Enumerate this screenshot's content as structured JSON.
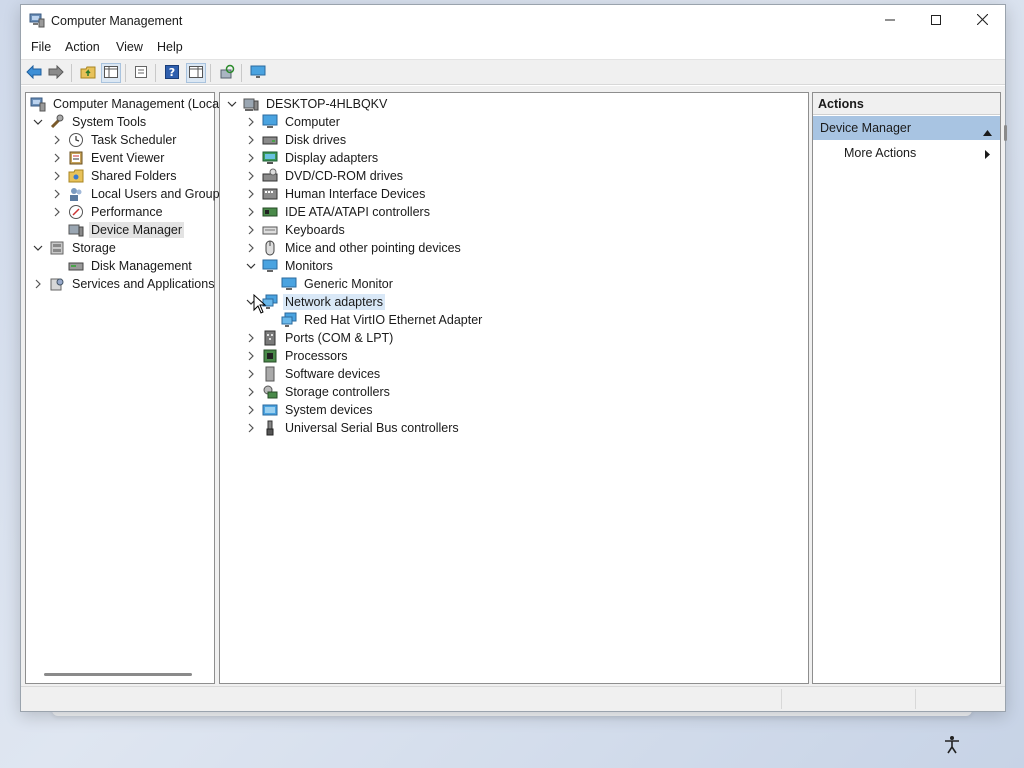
{
  "window": {
    "title": "Computer Management"
  },
  "menu": [
    "File",
    "Action",
    "View",
    "Help"
  ],
  "toolbar": {
    "buttons": [
      "back-icon",
      "forward-icon",
      "up-folder-icon",
      "show-hide-tree-icon",
      "properties-icon",
      "help-icon",
      "show-hide-action-pane-icon",
      "scan-hardware-icon",
      "monitor-icon"
    ]
  },
  "left_tree": {
    "root": "Computer Management (Local",
    "items": [
      {
        "label": "System Tools",
        "level": 1,
        "expander": "expanded",
        "icon": "tools-icon"
      },
      {
        "label": "Task Scheduler",
        "level": 2,
        "expander": "collapsed",
        "icon": "clock-icon"
      },
      {
        "label": "Event Viewer",
        "level": 2,
        "expander": "collapsed",
        "icon": "event-viewer-icon"
      },
      {
        "label": "Shared Folders",
        "level": 2,
        "expander": "collapsed",
        "icon": "shared-folder-icon"
      },
      {
        "label": "Local Users and Groups",
        "level": 2,
        "expander": "collapsed",
        "icon": "users-icon"
      },
      {
        "label": "Performance",
        "level": 2,
        "expander": "collapsed",
        "icon": "performance-icon"
      },
      {
        "label": "Device Manager",
        "level": 2,
        "expander": "none",
        "icon": "device-manager-icon",
        "selected": true
      },
      {
        "label": "Storage",
        "level": 1,
        "expander": "expanded",
        "icon": "storage-icon"
      },
      {
        "label": "Disk Management",
        "level": 2,
        "expander": "none",
        "icon": "disk-management-icon"
      },
      {
        "label": "Services and Applications",
        "level": 1,
        "expander": "collapsed",
        "icon": "services-icon"
      }
    ]
  },
  "device_tree": {
    "root": "DESKTOP-4HLBQKV",
    "items": [
      {
        "label": "Computer",
        "level": 1,
        "expander": "collapsed",
        "icon": "computer-icon"
      },
      {
        "label": "Disk drives",
        "level": 1,
        "expander": "collapsed",
        "icon": "disk-drive-icon"
      },
      {
        "label": "Display adapters",
        "level": 1,
        "expander": "collapsed",
        "icon": "display-adapter-icon"
      },
      {
        "label": "DVD/CD-ROM drives",
        "level": 1,
        "expander": "collapsed",
        "icon": "dvd-drive-icon"
      },
      {
        "label": "Human Interface Devices",
        "level": 1,
        "expander": "collapsed",
        "icon": "hid-icon"
      },
      {
        "label": "IDE ATA/ATAPI controllers",
        "level": 1,
        "expander": "collapsed",
        "icon": "ide-controller-icon"
      },
      {
        "label": "Keyboards",
        "level": 1,
        "expander": "collapsed",
        "icon": "keyboard-icon"
      },
      {
        "label": "Mice and other pointing devices",
        "level": 1,
        "expander": "collapsed",
        "icon": "mouse-icon"
      },
      {
        "label": "Monitors",
        "level": 1,
        "expander": "expanded",
        "icon": "monitor-icon"
      },
      {
        "label": "Generic Monitor",
        "level": 2,
        "expander": "none",
        "icon": "monitor-icon"
      },
      {
        "label": "Network adapters",
        "level": 1,
        "expander": "expanded",
        "icon": "network-adapter-icon",
        "selected": true
      },
      {
        "label": "Red Hat VirtIO Ethernet Adapter",
        "level": 2,
        "expander": "none",
        "icon": "network-adapter-icon"
      },
      {
        "label": "Ports (COM & LPT)",
        "level": 1,
        "expander": "collapsed",
        "icon": "port-icon"
      },
      {
        "label": "Processors",
        "level": 1,
        "expander": "collapsed",
        "icon": "processor-icon"
      },
      {
        "label": "Software devices",
        "level": 1,
        "expander": "collapsed",
        "icon": "software-device-icon"
      },
      {
        "label": "Storage controllers",
        "level": 1,
        "expander": "collapsed",
        "icon": "storage-controller-icon"
      },
      {
        "label": "System devices",
        "level": 1,
        "expander": "collapsed",
        "icon": "system-device-icon"
      },
      {
        "label": "Universal Serial Bus controllers",
        "level": 1,
        "expander": "collapsed",
        "icon": "usb-icon"
      }
    ]
  },
  "actions": {
    "header": "Actions",
    "section": "Device Manager",
    "items": [
      "More Actions"
    ]
  },
  "colors": {
    "selection_blue": "#d9e8f7",
    "actions_section": "#a8c4e2",
    "selection_gray": "#e3e3e3"
  }
}
